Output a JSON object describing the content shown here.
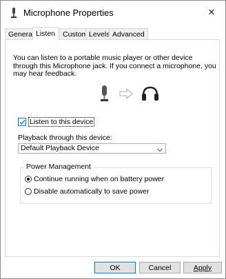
{
  "window": {
    "title": "Microphone Properties",
    "close_symbol": "✕"
  },
  "tabs": [
    {
      "label": "General"
    },
    {
      "label": "Listen",
      "active": true
    },
    {
      "label": "Custom"
    },
    {
      "label": "Levels"
    },
    {
      "label": "Advanced"
    }
  ],
  "listen": {
    "description": "You can listen to a portable music player or other device through this Microphone jack.  If you connect a microphone, you may hear feedback.",
    "checkbox_label": "Listen to this device",
    "checkbox_checked": true,
    "playback_label": "Playback through this device:",
    "playback_selected": "Default Playback Device"
  },
  "power": {
    "legend": "Power Management",
    "options": [
      {
        "label": "Continue running when on battery power",
        "selected": true
      },
      {
        "label": "Disable automatically to save power",
        "selected": false
      }
    ]
  },
  "buttons": {
    "ok": "OK",
    "cancel": "Cancel",
    "apply": "Apply"
  },
  "colors": {
    "accent": "#0078d7"
  }
}
